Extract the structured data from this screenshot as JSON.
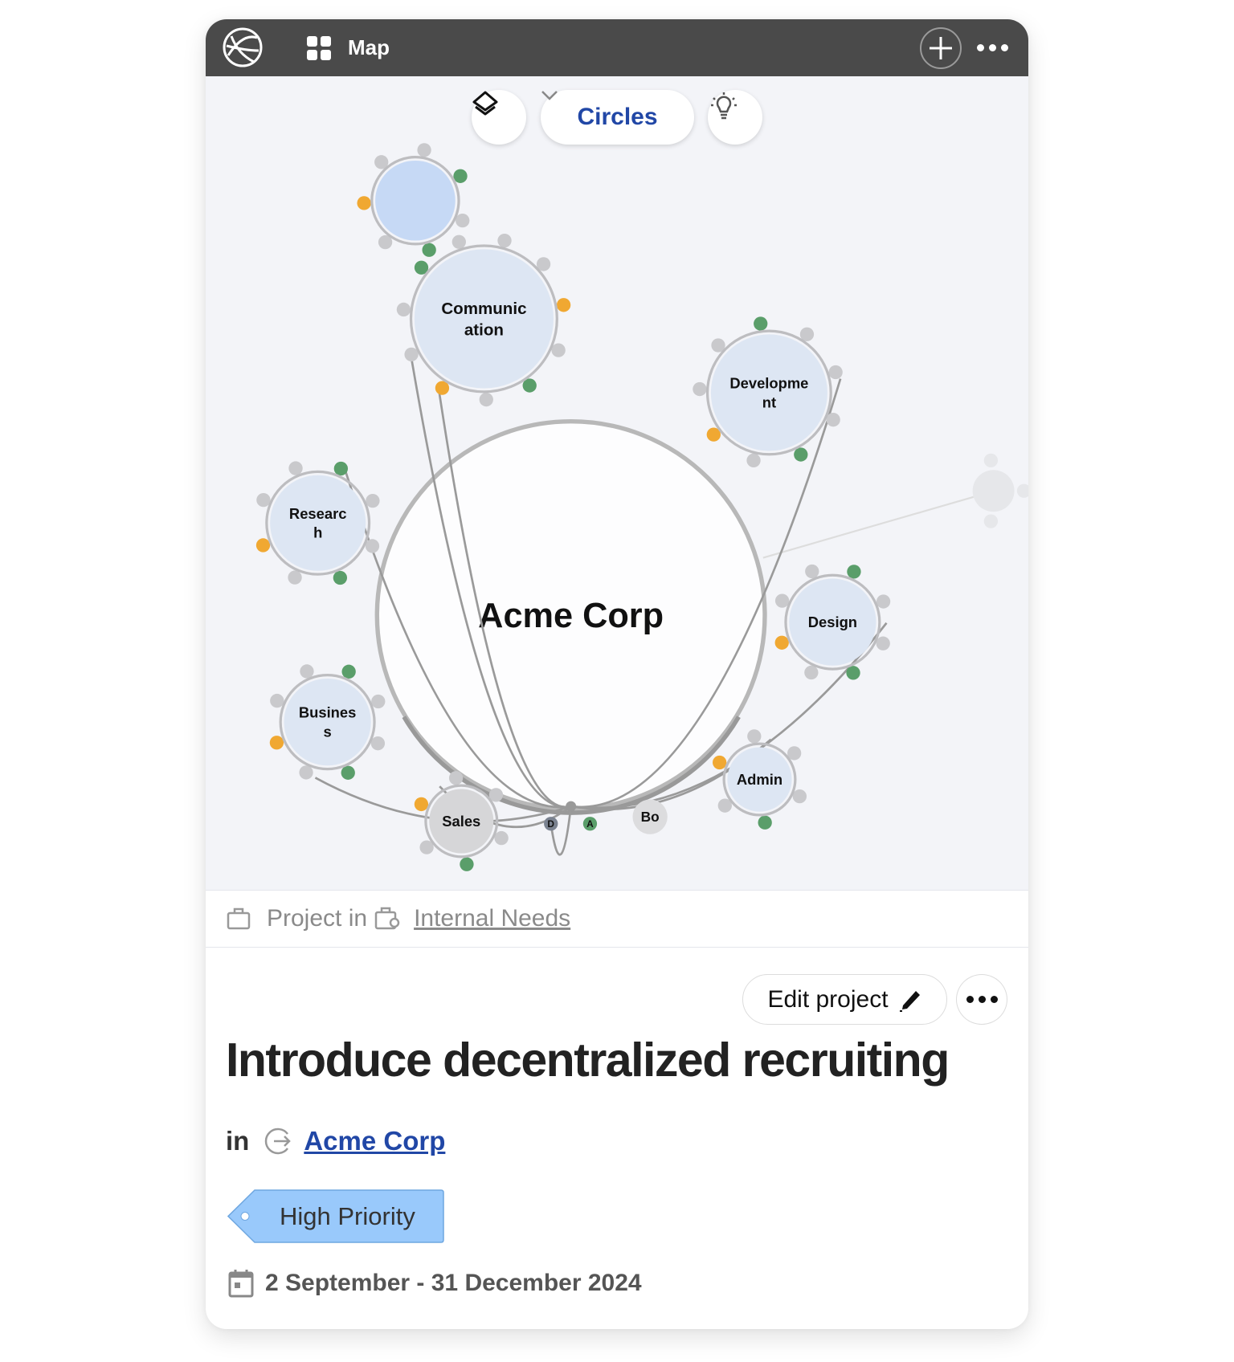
{
  "topbar": {
    "title": "Map",
    "icons": [
      "app-logo-icon",
      "grid-icon",
      "plus-icon",
      "more-icon"
    ]
  },
  "toolbar": {
    "view_select": "Circles",
    "icons": [
      "layers-icon",
      "chevron-down-icon",
      "lightbulb-icon"
    ]
  },
  "map": {
    "root": "Acme Corp",
    "circles": [
      {
        "label": [
          "Communic",
          "ation"
        ]
      },
      {
        "label": [
          "Developme",
          "nt"
        ]
      },
      {
        "label": [
          "Researc",
          "h"
        ]
      },
      {
        "label": [
          "Busines",
          "s"
        ]
      },
      {
        "label": [
          "Design"
        ]
      },
      {
        "label": [
          "Admin"
        ]
      },
      {
        "label": [
          "Sales"
        ]
      },
      {
        "label": [
          "Bo"
        ]
      },
      {
        "label": [
          "D"
        ]
      },
      {
        "label": [
          "A"
        ]
      }
    ],
    "colors": {
      "circle_fill": "#dde6f3",
      "highlight_fill": "#c6d9f5",
      "role_green": "#5a9e6a",
      "role_orange": "#f0a832",
      "link_grey": "#9a9a9a"
    }
  },
  "breadcrumb": {
    "type_label": "Project in",
    "parent": "Internal Needs"
  },
  "actions": {
    "edit_label": "Edit project"
  },
  "project": {
    "title": "Introduce decentralized recruiting",
    "in_label": "in",
    "circle": "Acme Corp",
    "tag": "High Priority",
    "tag_color": "#99c9fb",
    "dates": "2 September - 31 December 2024"
  }
}
